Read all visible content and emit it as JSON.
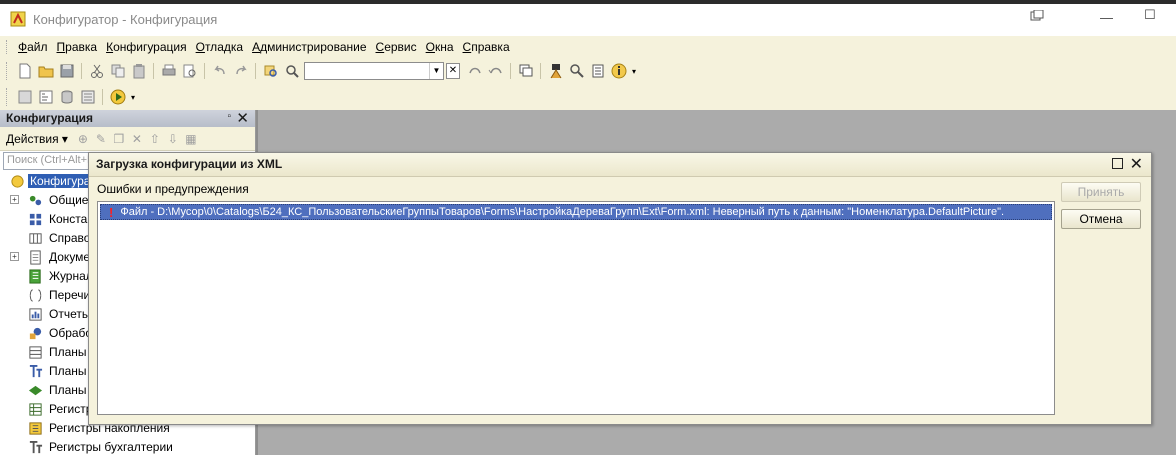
{
  "window": {
    "title": "Конфигуратор - Конфигурация"
  },
  "menu": [
    "Файл",
    "Правка",
    "Конфигурация",
    "Отладка",
    "Администрирование",
    "Сервис",
    "Окна",
    "Справка"
  ],
  "panel": {
    "title": "Конфигурация",
    "actions_label": "Действия",
    "search_placeholder": "Поиск (Ctrl+Alt+M)",
    "tree": [
      {
        "label": "Конфигурация",
        "icon": "config-icon"
      },
      {
        "label": "Общие",
        "icon": "common-icon",
        "expandable": true
      },
      {
        "label": "Константы",
        "icon": "constants-icon"
      },
      {
        "label": "Справочники",
        "icon": "catalogs-icon"
      },
      {
        "label": "Документы",
        "icon": "documents-icon",
        "expandable": true
      },
      {
        "label": "Журналы документов",
        "icon": "journals-icon"
      },
      {
        "label": "Перечисления",
        "icon": "enums-icon"
      },
      {
        "label": "Отчеты",
        "icon": "reports-icon"
      },
      {
        "label": "Обработки",
        "icon": "processing-icon"
      },
      {
        "label": "Планы видов характеристик",
        "icon": "char-plans-icon"
      },
      {
        "label": "Планы счетов",
        "icon": "accounts-plans-icon"
      },
      {
        "label": "Планы видов расчета",
        "icon": "calc-plans-icon"
      },
      {
        "label": "Регистры сведений",
        "icon": "info-registers-icon"
      },
      {
        "label": "Регистры накопления",
        "icon": "accum-registers-icon"
      },
      {
        "label": "Регистры бухгалтерии",
        "icon": "accounting-registers-icon"
      }
    ]
  },
  "dialog": {
    "title": "Загрузка конфигурации из XML",
    "list_label": "Ошибки и предупреждения",
    "errors": [
      "Файл - D:\\Мусор\\0\\Catalogs\\Б24_КС_ПользовательскиеГруппыТоваров\\Forms\\НастройкаДереваГрупп\\Ext\\Form.xml: Неверный путь к данным: \"Номенклатура.DefaultPicture\"."
    ],
    "accept_label": "Принять",
    "cancel_label": "Отмена"
  },
  "colors": {
    "chrome": "#f5f2dc",
    "selection": "#4f6fbe",
    "error": "#ff1f1f"
  }
}
